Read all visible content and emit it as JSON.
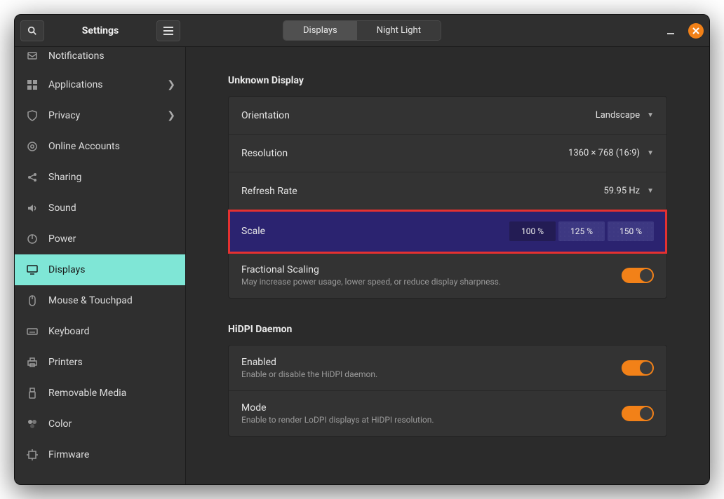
{
  "window": {
    "title": "Settings"
  },
  "tabs": {
    "displays": "Displays",
    "night_light": "Night Light"
  },
  "sidebar": {
    "items": [
      {
        "label": "Notifications"
      },
      {
        "label": "Applications"
      },
      {
        "label": "Privacy"
      },
      {
        "label": "Online Accounts"
      },
      {
        "label": "Sharing"
      },
      {
        "label": "Sound"
      },
      {
        "label": "Power"
      },
      {
        "label": "Displays"
      },
      {
        "label": "Mouse & Touchpad"
      },
      {
        "label": "Keyboard"
      },
      {
        "label": "Printers"
      },
      {
        "label": "Removable Media"
      },
      {
        "label": "Color"
      },
      {
        "label": "Firmware"
      }
    ]
  },
  "display_section": {
    "title": "Unknown Display",
    "orientation": {
      "label": "Orientation",
      "value": "Landscape"
    },
    "resolution": {
      "label": "Resolution",
      "value": "1360 × 768 (16∶9)"
    },
    "refresh": {
      "label": "Refresh Rate",
      "value": "59.95 Hz"
    },
    "scale": {
      "label": "Scale",
      "options": [
        "100 %",
        "125 %",
        "150 %"
      ],
      "selected": "100 %"
    },
    "fractional": {
      "label": "Fractional Scaling",
      "desc": "May increase power usage, lower speed, or reduce display sharpness.",
      "on": true
    }
  },
  "hidpi": {
    "title": "HiDPI Daemon",
    "enabled": {
      "label": "Enabled",
      "desc": "Enable or disable the HiDPI daemon.",
      "on": true
    },
    "mode": {
      "label": "Mode",
      "desc": "Enable to render LoDPI displays at HiDPI resolution.",
      "on": true
    }
  }
}
